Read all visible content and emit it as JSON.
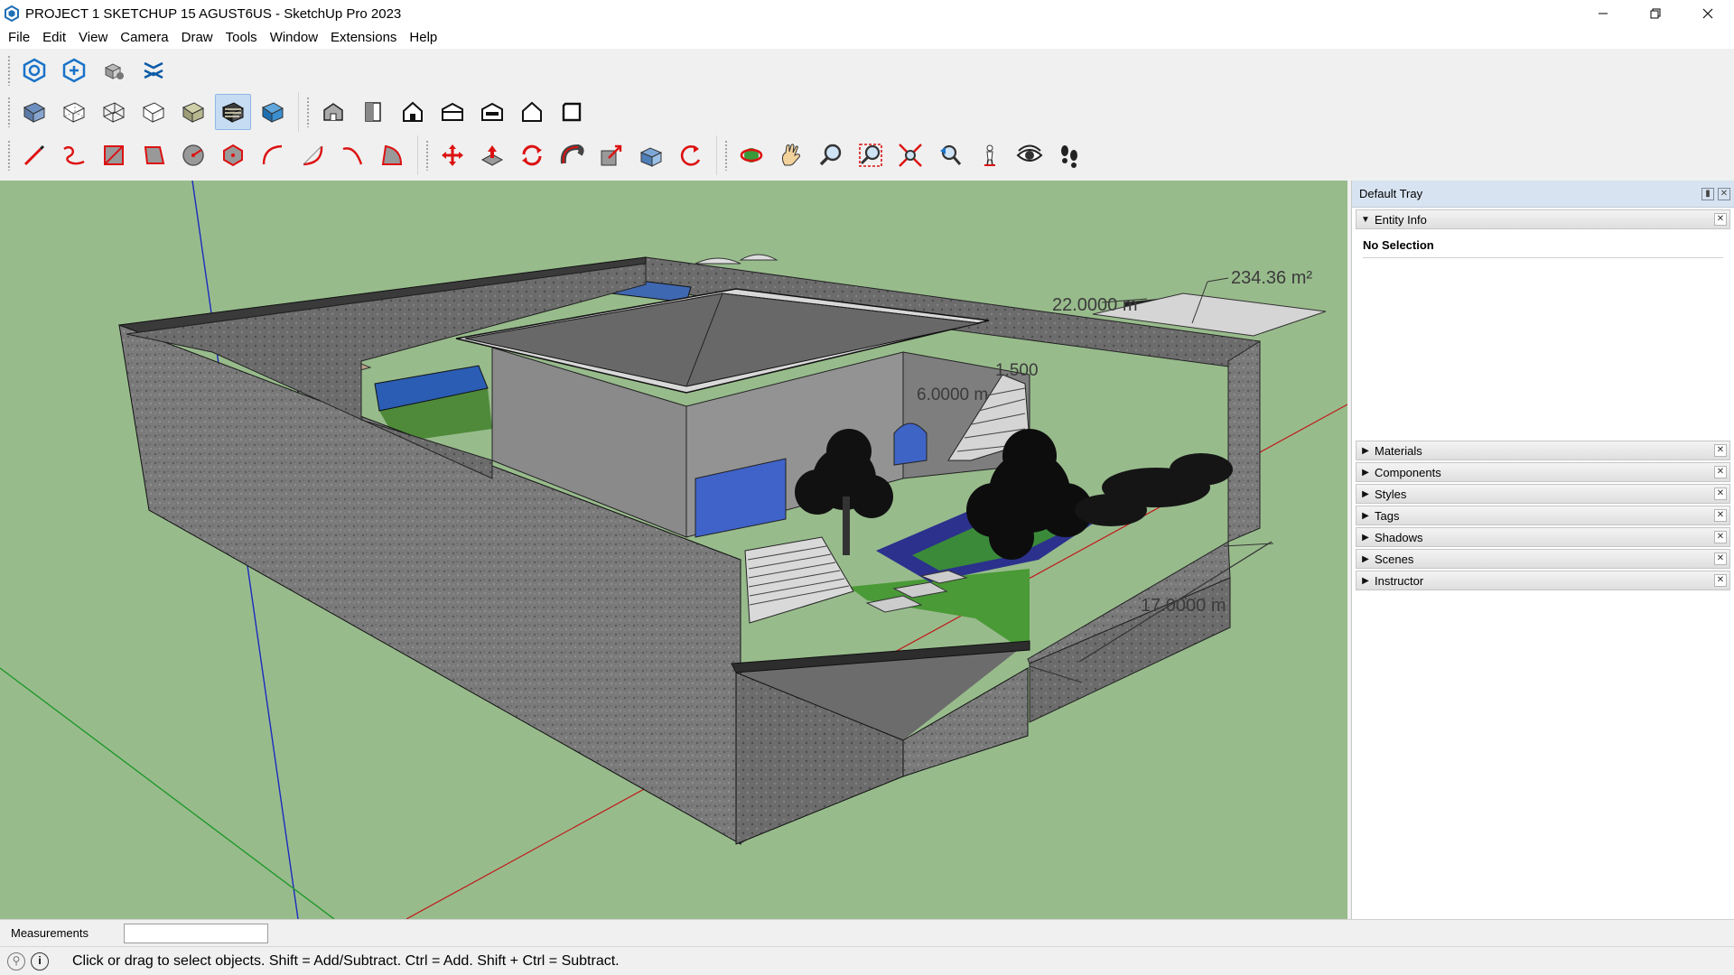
{
  "window": {
    "title": "PROJECT 1 SKETCHUP 15 AGUST6US - SketchUp Pro 2023",
    "app_icon": "sketchup-logo-icon",
    "controls": [
      "minimize-icon",
      "restore-icon",
      "close-icon"
    ]
  },
  "menu": [
    "File",
    "Edit",
    "View",
    "Camera",
    "Draw",
    "Tools",
    "Window",
    "Extensions",
    "Help"
  ],
  "toolbars": {
    "row1": [
      "warehouse-icon",
      "extension-warehouse-icon",
      "extension-manager-icon",
      "trimble-connect-icon"
    ],
    "row2_styles": [
      "xray-icon",
      "back-edges-icon",
      "wireframe-icon",
      "hidden-line-icon",
      "shaded-icon",
      "shaded-textures-icon",
      "monochrome-icon"
    ],
    "row2_views": [
      "iso-view-icon",
      "top-view-icon",
      "front-view-icon",
      "right-view-icon",
      "back-view-icon",
      "left-view-icon",
      "bottom-view-icon"
    ],
    "row3_draw": [
      "pencil-line-icon",
      "freehand-icon",
      "rectangle-icon",
      "rotated-rectangle-icon",
      "circle-icon",
      "polygon-icon",
      "arc-icon",
      "two-point-arc-icon",
      "three-point-arc-icon",
      "pie-icon"
    ],
    "row3_edit": [
      "move-icon",
      "push-pull-icon",
      "rotate-icon",
      "follow-me-icon",
      "scale-icon",
      "offset-icon",
      "flip-icon"
    ],
    "row3_camera": [
      "orbit-icon",
      "pan-icon",
      "zoom-icon",
      "zoom-window-icon",
      "zoom-extents-icon",
      "previous-view-icon",
      "position-camera-icon",
      "look-around-icon",
      "walk-icon"
    ],
    "active_style": "shaded-textures-icon"
  },
  "viewport": {
    "background": "#98bb8c",
    "dimensions": {
      "length": "22.0000 m",
      "width": "17.0000 m",
      "height": "6.0000 m",
      "step": "1.500",
      "area": "234.36 m²"
    }
  },
  "tray": {
    "title": "Default Tray",
    "entity_info": {
      "label": "Entity Info",
      "selection": "No Selection"
    },
    "panels": [
      "Materials",
      "Components",
      "Styles",
      "Tags",
      "Shadows",
      "Scenes",
      "Instructor"
    ]
  },
  "measurements": {
    "label": "Measurements",
    "value": ""
  },
  "status": {
    "geo_icon": "geolocation-icon",
    "info_icon": "info-icon",
    "text": "Click or drag to select objects. Shift = Add/Subtract. Ctrl = Add. Shift + Ctrl = Subtract."
  }
}
